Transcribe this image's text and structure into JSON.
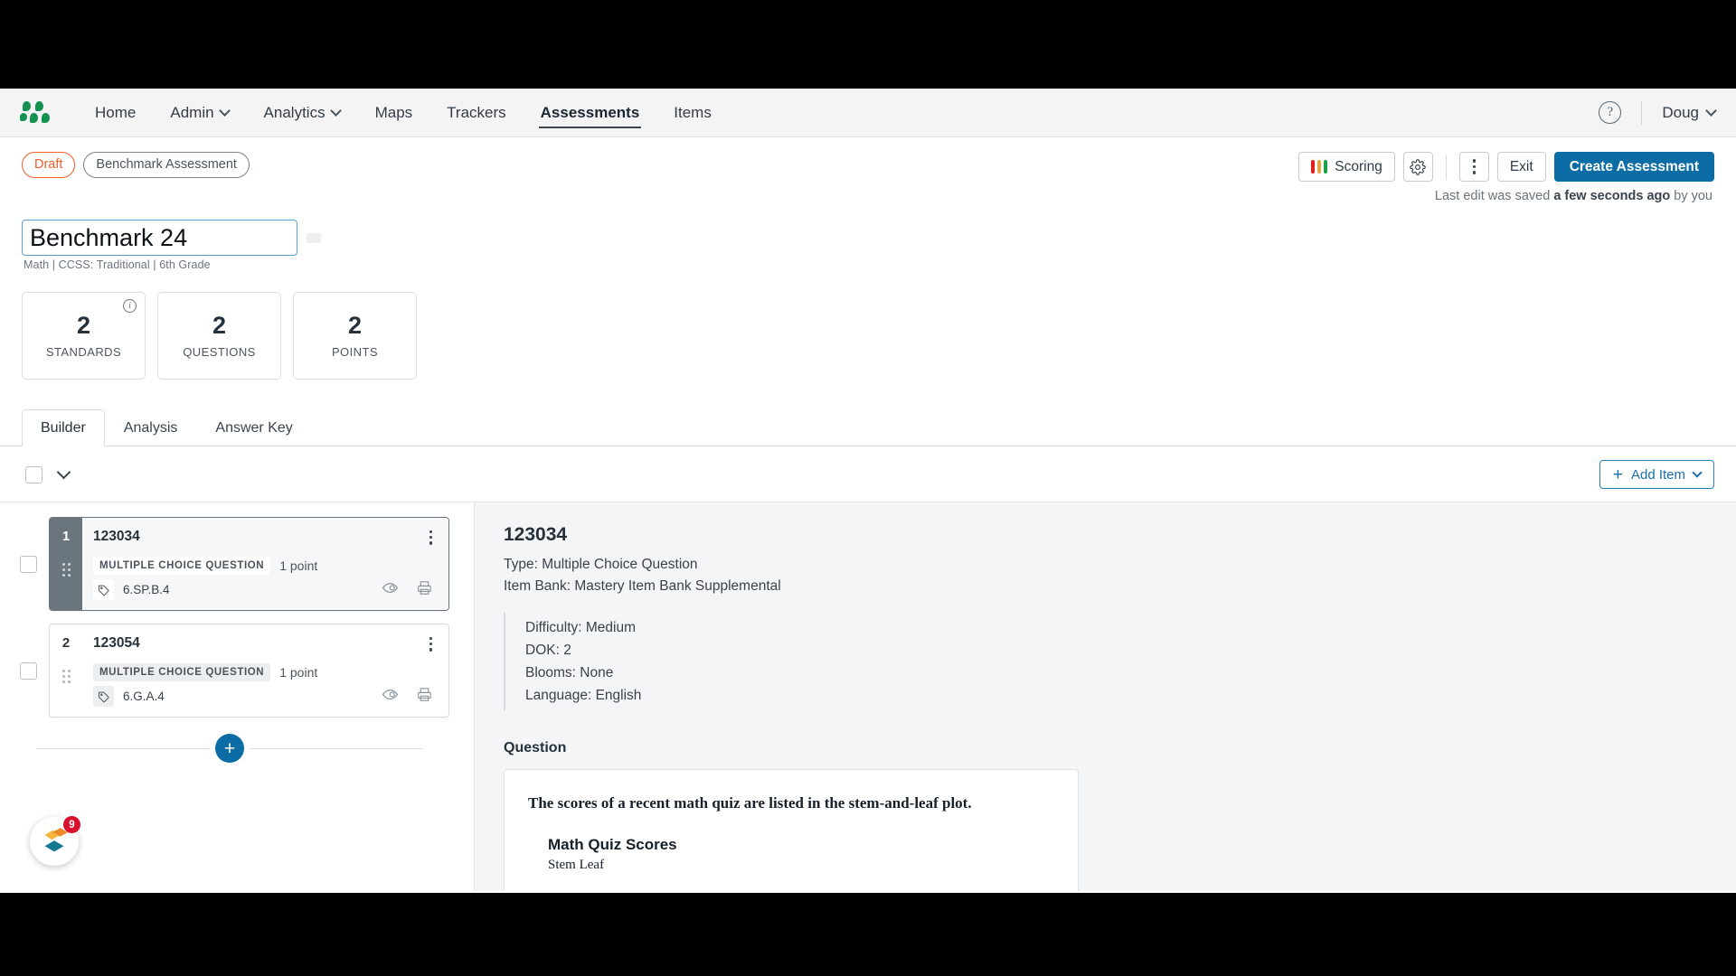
{
  "nav": {
    "logo_icon": "mastery-dots-logo",
    "items": [
      {
        "label": "Home",
        "has_caret": false,
        "active": false
      },
      {
        "label": "Admin",
        "has_caret": true,
        "active": false
      },
      {
        "label": "Analytics",
        "has_caret": true,
        "active": false
      },
      {
        "label": "Maps",
        "has_caret": false,
        "active": false
      },
      {
        "label": "Trackers",
        "has_caret": false,
        "active": false
      },
      {
        "label": "Assessments",
        "has_caret": false,
        "active": true
      },
      {
        "label": "Items",
        "has_caret": false,
        "active": false
      }
    ],
    "help_glyph": "?",
    "user_label": "Doug"
  },
  "actionbar": {
    "status_badge": "Draft",
    "type_badge": "Benchmark Assessment",
    "scoring_label": "Scoring",
    "scoring_colors": [
      "#e02020",
      "#e8a33d",
      "#17a24a"
    ],
    "exit_label": "Exit",
    "create_label": "Create Assessment",
    "saved_prefix": "Last edit was saved ",
    "saved_strong": "a few seconds ago",
    "saved_suffix": " by you"
  },
  "title": {
    "value": "Benchmark 24 ",
    "placeholder": "Assessment name",
    "subtitle": "Math  |  CCSS: Traditional  |  6th Grade"
  },
  "stats": [
    {
      "num": "2",
      "label": "STANDARDS",
      "info": true
    },
    {
      "num": "2",
      "label": "QUESTIONS",
      "info": false
    },
    {
      "num": "2",
      "label": "POINTS",
      "info": false
    }
  ],
  "tabs": [
    {
      "label": "Builder",
      "active": true
    },
    {
      "label": "Analysis",
      "active": false
    },
    {
      "label": "Answer Key",
      "active": false
    }
  ],
  "toolbar": {
    "add_item_label": "Add Item",
    "plus_glyph": "+"
  },
  "items": [
    {
      "number": "1",
      "id": "123034",
      "qtype": "MULTIPLE CHOICE QUESTION",
      "points": "1 point",
      "standard": "6.SP.B.4",
      "selected": true
    },
    {
      "number": "2",
      "id": "123054",
      "qtype": "MULTIPLE CHOICE QUESTION",
      "points": "1 point",
      "standard": "6.G.A.4",
      "selected": false
    }
  ],
  "launcher": {
    "badge_count": "9"
  },
  "detail": {
    "title": "123034",
    "type_line": "Type: Multiple Choice Question",
    "bank_line": "Item Bank: Mastery Item Bank Supplemental",
    "attributes": [
      "Difficulty: Medium",
      "DOK: 2",
      "Blooms: None",
      "Language: English"
    ],
    "question_heading": "Question",
    "question_text": "The scores of a recent math quiz are listed in the stem-and-leaf plot.",
    "question_chart_title": "Math Quiz Scores",
    "question_chart_sub": "Stem    Leaf"
  }
}
